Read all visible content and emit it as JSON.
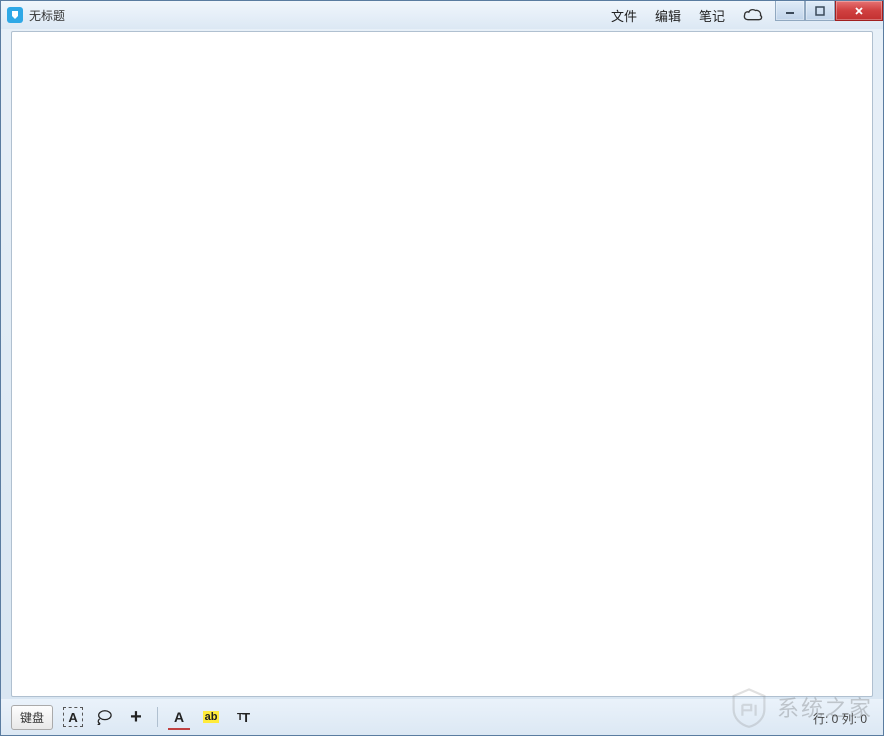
{
  "window": {
    "title": "无标题"
  },
  "menus": {
    "file": "文件",
    "edit": "编辑",
    "note": "笔记"
  },
  "toolbar": {
    "keyboard_label": "键盘",
    "text_select_label": "A",
    "font_color_label": "A",
    "highlight_label": "ab"
  },
  "status": {
    "position": "行: 0 列: 0"
  },
  "watermark": {
    "text": "系统之家"
  }
}
